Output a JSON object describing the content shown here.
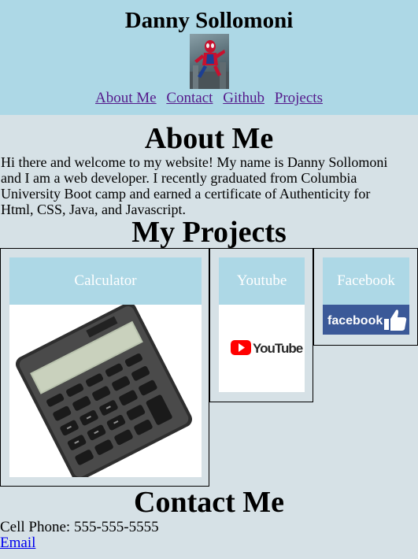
{
  "header": {
    "title": "Danny Sollomoni",
    "avatar_icon": "spiderman-avatar-icon",
    "nav": [
      "About Me",
      "Contact",
      "Github",
      "Projects"
    ]
  },
  "about": {
    "heading": "About Me",
    "text": "Hi there and welcome to my website! My name is Danny Sollomoni and I am a web developer. I recently graduated from Columbia University Boot camp and earned a certificate of Authenticity for Html, CSS, Java, and Javascript."
  },
  "projects": {
    "heading": "My Projects",
    "items": [
      {
        "label": "Calculator",
        "icon": "calculator-icon"
      },
      {
        "label": "Youtube",
        "icon": "youtube-logo-icon",
        "logo_text": "YouTube"
      },
      {
        "label": "Facebook",
        "icon": "facebook-logo-icon",
        "logo_text": "facebook"
      }
    ]
  },
  "contact": {
    "heading": "Contact Me",
    "phone": "Cell Phone: 555-555-5555",
    "email_label": "Email"
  },
  "colors": {
    "page_bg": "#d6e1e6",
    "header_bg": "#add8e6",
    "visited_link": "#551a8b",
    "link": "#0000ee",
    "youtube_red": "#ff0000",
    "facebook_blue": "#3b5998"
  }
}
